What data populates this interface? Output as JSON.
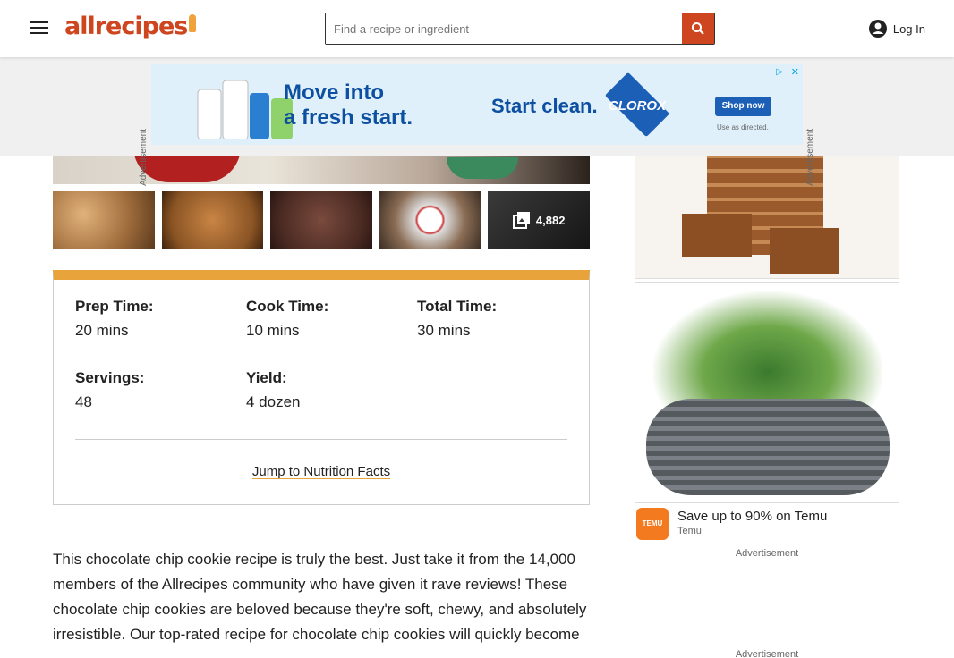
{
  "header": {
    "logo_text": "allrecipes",
    "search_placeholder": "Find a recipe or ingredient",
    "login_label": "Log In"
  },
  "top_ad": {
    "side_label": "Advertisement",
    "headline_line1": "Move into",
    "headline_line2": "a fresh start.",
    "tagline": "Start clean.",
    "brand": "CLOROX",
    "cta": "Shop now",
    "disclaimer": "Use as directed."
  },
  "gallery": {
    "photo_count": "4,882"
  },
  "details": {
    "prep_label": "Prep Time:",
    "prep_value": "20 mins",
    "cook_label": "Cook Time:",
    "cook_value": "10 mins",
    "total_label": "Total Time:",
    "total_value": "30 mins",
    "servings_label": "Servings:",
    "servings_value": "48",
    "yield_label": "Yield:",
    "yield_value": "4 dozen",
    "jump_link": "Jump to Nutrition Facts"
  },
  "intro_text": "This chocolate chip cookie recipe is truly the best. Just take it from the 14,000 members of the Allrecipes community who have given it rave reviews! These chocolate chip cookies are beloved because they're soft, chewy, and absolutely irresistible. Our top-rated recipe for chocolate chip cookies will quickly become",
  "right_ads": {
    "temu_headline": "Save up to 90% on Temu",
    "temu_brand": "Temu",
    "temu_logo": "TEMU",
    "ad_label": "Advertisement"
  },
  "colors": {
    "brand": "#ce4620",
    "accent": "#e8a33a"
  }
}
